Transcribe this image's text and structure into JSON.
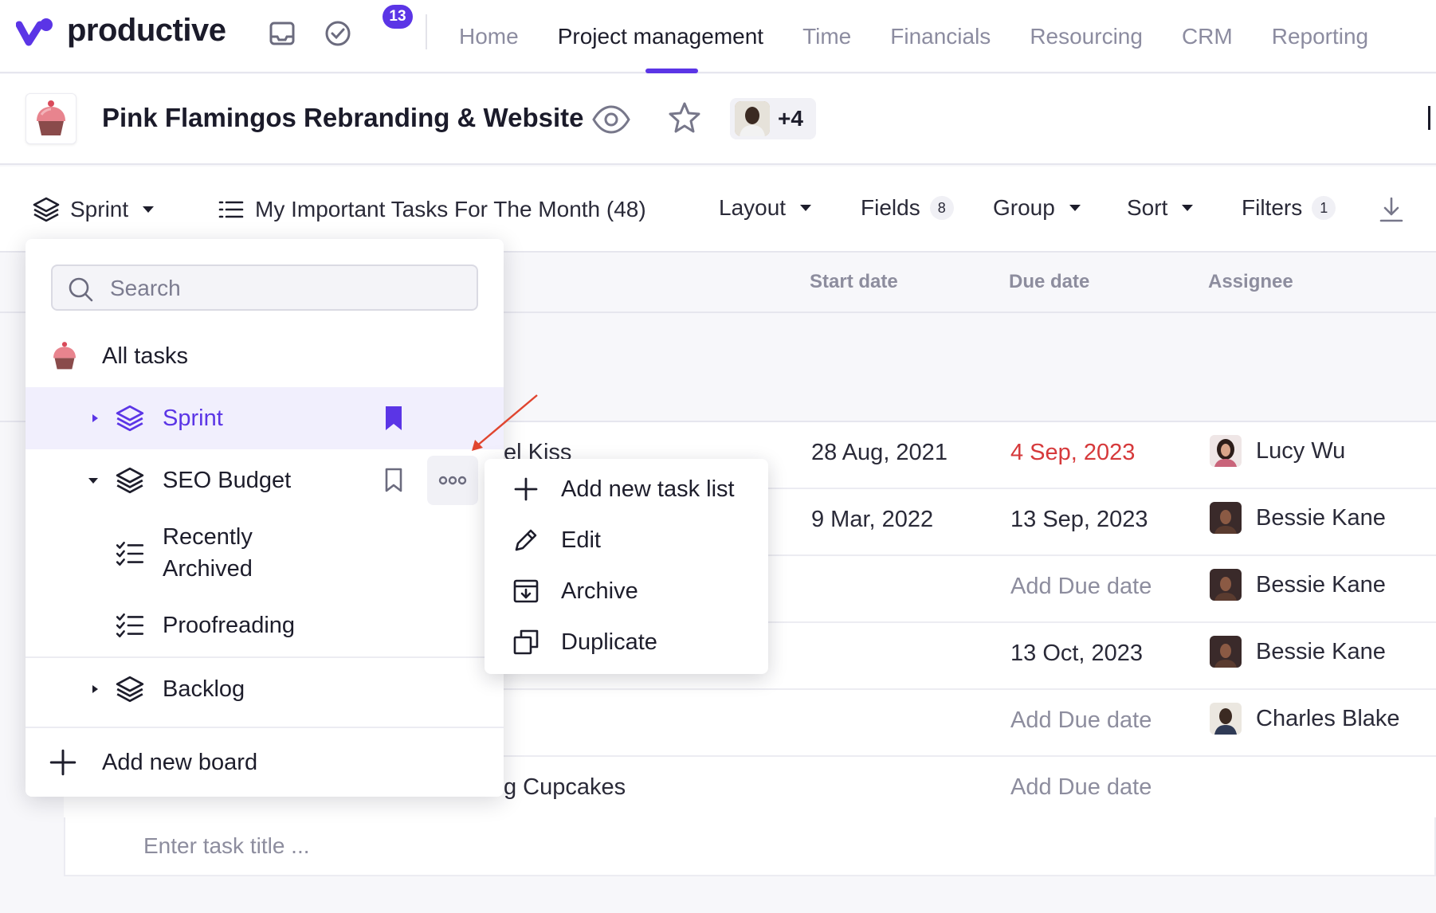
{
  "nav": {
    "brand": "productive",
    "notifications_count": "13",
    "links": [
      {
        "label": "Home",
        "active": false
      },
      {
        "label": "Project management",
        "active": true
      },
      {
        "label": "Time",
        "active": false
      },
      {
        "label": "Financials",
        "active": false
      },
      {
        "label": "Resourcing",
        "active": false
      },
      {
        "label": "CRM",
        "active": false
      },
      {
        "label": "Reporting",
        "active": false
      }
    ],
    "icons": [
      "inbox-icon",
      "tasks-check-icon"
    ],
    "accent": "#5b35e6"
  },
  "project": {
    "title": "Pink Flamingos Rebranding & Website",
    "members_more": "+4",
    "icons": [
      "cupcake-icon",
      "eye-icon",
      "star-icon"
    ]
  },
  "toolbar": {
    "board": "Sprint",
    "view": "My Important Tasks For The Month (48)",
    "layout": "Layout",
    "fields": "Fields",
    "fields_count": "8",
    "group": "Group",
    "sort": "Sort",
    "filters": "Filters",
    "filters_count": "1"
  },
  "table": {
    "headers": {
      "start": "Start date",
      "due": "Due date",
      "assignee": "Assignee"
    },
    "rows": [
      {
        "title": "el Kiss",
        "start": "28 Aug, 2021",
        "due": "4 Sep, 2023",
        "due_overdue": true,
        "assignee": "Lucy Wu"
      },
      {
        "title": "",
        "start": "9 Mar, 2022",
        "due": "13 Sep, 2023",
        "due_overdue": false,
        "assignee": "Bessie Kane"
      },
      {
        "title": "",
        "start": "",
        "due": "Add Due date",
        "due_overdue": false,
        "assignee": "Bessie Kane"
      },
      {
        "title": "",
        "start": "",
        "due": "13 Oct, 2023",
        "due_overdue": false,
        "assignee": "Bessie Kane"
      },
      {
        "title": "",
        "start": "",
        "due": "Add Due date",
        "due_overdue": false,
        "assignee": "Charles Blake"
      },
      {
        "title": "g Cupcakes",
        "start": "",
        "due": "Add Due date",
        "due_overdue": false,
        "assignee": ""
      }
    ],
    "new_task_placeholder": "Enter task title ...",
    "overdue_color": "#d6393b"
  },
  "board_panel": {
    "search_placeholder": "Search",
    "all_tasks": "All tasks",
    "items": [
      {
        "label": "Sprint",
        "selected": true,
        "expanded": false,
        "bookmarked": true
      },
      {
        "label": "SEO Budget",
        "selected": false,
        "expanded": true,
        "bookmarked": false
      },
      {
        "label": "Recently Archived",
        "type": "task-list"
      },
      {
        "label": "Proofreading",
        "type": "task-list"
      },
      {
        "label": "Backlog",
        "selected": false,
        "expanded": false,
        "bookmarked": false
      }
    ],
    "add_board": "Add new board"
  },
  "context_menu": {
    "items": [
      {
        "label": "Add new task list",
        "icon": "plus-icon"
      },
      {
        "label": "Edit",
        "icon": "pencil-icon"
      },
      {
        "label": "Archive",
        "icon": "archive-icon"
      },
      {
        "label": "Duplicate",
        "icon": "duplicate-icon"
      }
    ]
  }
}
